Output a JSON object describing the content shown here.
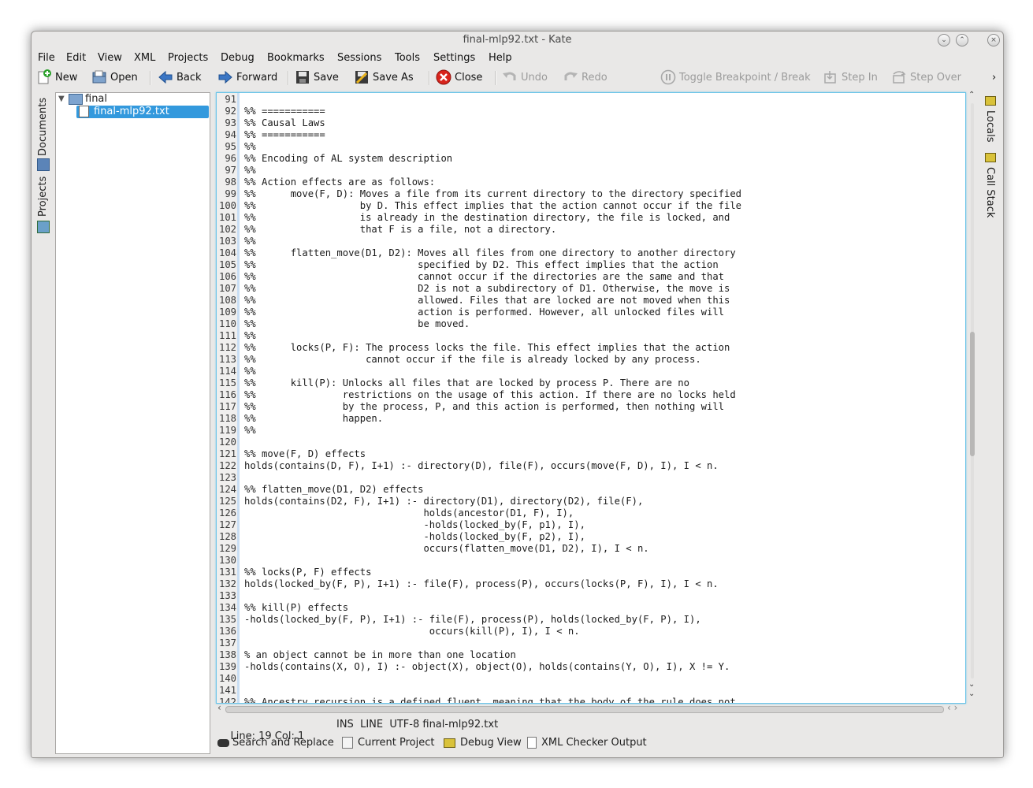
{
  "window": {
    "title": "final-mlp92.txt - Kate"
  },
  "menu": [
    "File",
    "Edit",
    "View",
    "XML",
    "Projects",
    "Debug",
    "Bookmarks",
    "Sessions",
    "Tools",
    "Settings",
    "Help"
  ],
  "toolbar": {
    "new": "New",
    "open": "Open",
    "back": "Back",
    "forward": "Forward",
    "save": "Save",
    "save_as": "Save As",
    "close": "Close",
    "undo": "Undo",
    "redo": "Redo",
    "toggle_breakpoint": "Toggle Breakpoint / Break",
    "step_in": "Step In",
    "step_over": "Step Over",
    "overflow": "›"
  },
  "left_tabs": {
    "documents": "Documents",
    "projects": "Projects"
  },
  "right_tabs": {
    "locals": "Locals",
    "call_stack": "Call Stack"
  },
  "tree": {
    "folder": "final",
    "file": "final-mlp92.txt"
  },
  "editor": {
    "lines": [
      {
        "n": "91",
        "t": ""
      },
      {
        "n": "92",
        "t": "%% ==========="
      },
      {
        "n": "93",
        "t": "%% Causal Laws"
      },
      {
        "n": "94",
        "t": "%% ==========="
      },
      {
        "n": "95",
        "t": "%%"
      },
      {
        "n": "96",
        "t": "%% Encoding of AL system description"
      },
      {
        "n": "97",
        "t": "%%"
      },
      {
        "n": "98",
        "t": "%% Action effects are as follows:"
      },
      {
        "n": "99",
        "t": "%%      move(F, D): Moves a file from its current directory to the directory specified"
      },
      {
        "n": "100",
        "t": "%%                  by D. This effect implies that the action cannot occur if the file"
      },
      {
        "n": "101",
        "t": "%%                  is already in the destination directory, the file is locked, and"
      },
      {
        "n": "102",
        "t": "%%                  that F is a file, not a directory."
      },
      {
        "n": "103",
        "t": "%%"
      },
      {
        "n": "104",
        "t": "%%      flatten_move(D1, D2): Moves all files from one directory to another directory"
      },
      {
        "n": "105",
        "t": "%%                            specified by D2. This effect implies that the action"
      },
      {
        "n": "106",
        "t": "%%                            cannot occur if the directories are the same and that"
      },
      {
        "n": "107",
        "t": "%%                            D2 is not a subdirectory of D1. Otherwise, the move is"
      },
      {
        "n": "108",
        "t": "%%                            allowed. Files that are locked are not moved when this"
      },
      {
        "n": "109",
        "t": "%%                            action is performed. However, all unlocked files will"
      },
      {
        "n": "110",
        "t": "%%                            be moved."
      },
      {
        "n": "111",
        "t": "%%"
      },
      {
        "n": "112",
        "t": "%%      locks(P, F): The process locks the file. This effect implies that the action"
      },
      {
        "n": "113",
        "t": "%%                   cannot occur if the file is already locked by any process."
      },
      {
        "n": "114",
        "t": "%%"
      },
      {
        "n": "115",
        "t": "%%      kill(P): Unlocks all files that are locked by process P. There are no"
      },
      {
        "n": "116",
        "t": "%%               restrictions on the usage of this action. If there are no locks held"
      },
      {
        "n": "117",
        "t": "%%               by the process, P, and this action is performed, then nothing will"
      },
      {
        "n": "118",
        "t": "%%               happen."
      },
      {
        "n": "119",
        "t": "%%"
      },
      {
        "n": "120",
        "t": ""
      },
      {
        "n": "121",
        "t": "%% move(F, D) effects"
      },
      {
        "n": "122",
        "t": "holds(contains(D, F), I+1) :- directory(D), file(F), occurs(move(F, D), I), I < n."
      },
      {
        "n": "123",
        "t": ""
      },
      {
        "n": "124",
        "t": "%% flatten_move(D1, D2) effects"
      },
      {
        "n": "125",
        "t": "holds(contains(D2, F), I+1) :- directory(D1), directory(D2), file(F),"
      },
      {
        "n": "126",
        "t": "                               holds(ancestor(D1, F), I),"
      },
      {
        "n": "127",
        "t": "                               -holds(locked_by(F, p1), I),"
      },
      {
        "n": "128",
        "t": "                               -holds(locked_by(F, p2), I),"
      },
      {
        "n": "129",
        "t": "                               occurs(flatten_move(D1, D2), I), I < n."
      },
      {
        "n": "130",
        "t": ""
      },
      {
        "n": "131",
        "t": "%% locks(P, F) effects"
      },
      {
        "n": "132",
        "t": "holds(locked_by(F, P), I+1) :- file(F), process(P), occurs(locks(P, F), I), I < n."
      },
      {
        "n": "133",
        "t": ""
      },
      {
        "n": "134",
        "t": "%% kill(P) effects"
      },
      {
        "n": "135",
        "t": "-holds(locked_by(F, P), I+1) :- file(F), process(P), holds(locked_by(F, P), I),"
      },
      {
        "n": "136",
        "t": "                                occurs(kill(P), I), I < n."
      },
      {
        "n": "137",
        "t": ""
      },
      {
        "n": "138",
        "t": "% an object cannot be in more than one location"
      },
      {
        "n": "139",
        "t": "-holds(contains(X, O), I) :- object(X), object(O), holds(contains(Y, O), I), X != Y."
      },
      {
        "n": "140",
        "t": ""
      },
      {
        "n": "141",
        "t": ""
      },
      {
        "n": "142",
        "t": "%% Ancestry recursion is a defined fluent, meaning that the body of the rule does not"
      }
    ]
  },
  "status": {
    "position": "Line: 19 Col: 1",
    "mode": "INS  LINE  UTF-8 final-mlp92.txt"
  },
  "bottom_tabs": {
    "search": "Search and Replace",
    "project": "Current Project",
    "debug": "Debug View",
    "xml": "XML Checker Output"
  },
  "colors": {
    "accent": "#3daee9",
    "selection": "#3399dd",
    "editor_border": "#6ec5e8"
  }
}
